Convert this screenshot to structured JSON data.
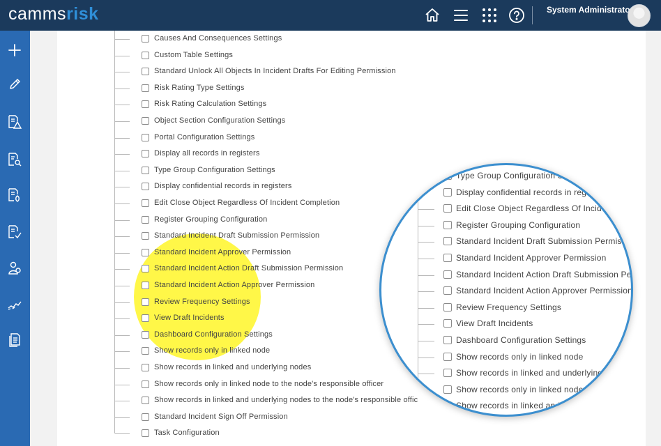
{
  "app": {
    "logo_part1": "camms",
    "logo_part2": "risk",
    "brand_colors": {
      "topbar": "#1b3a5c",
      "sidebar": "#2a6ab3",
      "accent": "#2f8fd8",
      "highlight": "#fff514"
    }
  },
  "header": {
    "icons": [
      "home-icon",
      "menu-icon",
      "apps-grid-icon",
      "help-icon"
    ],
    "user_name": "System Administrator"
  },
  "sidebar": {
    "icons": [
      "add-icon",
      "edit-icon",
      "risk-report-icon",
      "search-report-icon",
      "incident-report-icon",
      "checklist-report-icon",
      "users-icon",
      "trend-icon",
      "documents-icon"
    ]
  },
  "permissions": {
    "items": [
      "Causes And Consequences Settings",
      "Custom Table Settings",
      "Standard Unlock All Objects In Incident Drafts For Editing Permission",
      "Risk Rating Type Settings",
      "Risk Rating Calculation Settings",
      "Object Section Configuration Settings",
      "Portal Configuration Settings",
      "Display all records in registers",
      "Type Group Configuration Settings",
      "Display confidential records in registers",
      "Edit Close Object Regardless Of Incident Completion",
      "Register Grouping Configuration",
      "Standard Incident Draft Submission Permission",
      "Standard Incident Approver Permission",
      "Standard Incident Action Draft Submission Permission",
      "Standard Incident Action Approver Permission",
      "Review Frequency Settings",
      "View Draft Incidents",
      "Dashboard Configuration Settings",
      "Show records only in linked node",
      "Show records in linked and underlying nodes",
      "Show records only in linked node to the node's responsible officer",
      "Show records in linked and underlying nodes to the node's responsible offic",
      "Standard Incident Sign Off Permission",
      "Task Configuration"
    ]
  },
  "magnifier": {
    "items": [
      "Type Group Configuration Se",
      "Display confidential records in registe",
      "Edit Close Object Regardless Of Incident",
      "Register Grouping Configuration",
      "Standard Incident Draft Submission Permission",
      "Standard Incident Approver Permission",
      "Standard Incident Action Draft Submission Permis",
      "Standard Incident Action Approver Permission",
      "Review Frequency Settings",
      "View Draft Incidents",
      "Dashboard Configuration Settings",
      "Show records only in linked node",
      "Show records in linked and underlying no",
      "Show records only in linked node to t",
      "Show records in linked and u"
    ]
  }
}
